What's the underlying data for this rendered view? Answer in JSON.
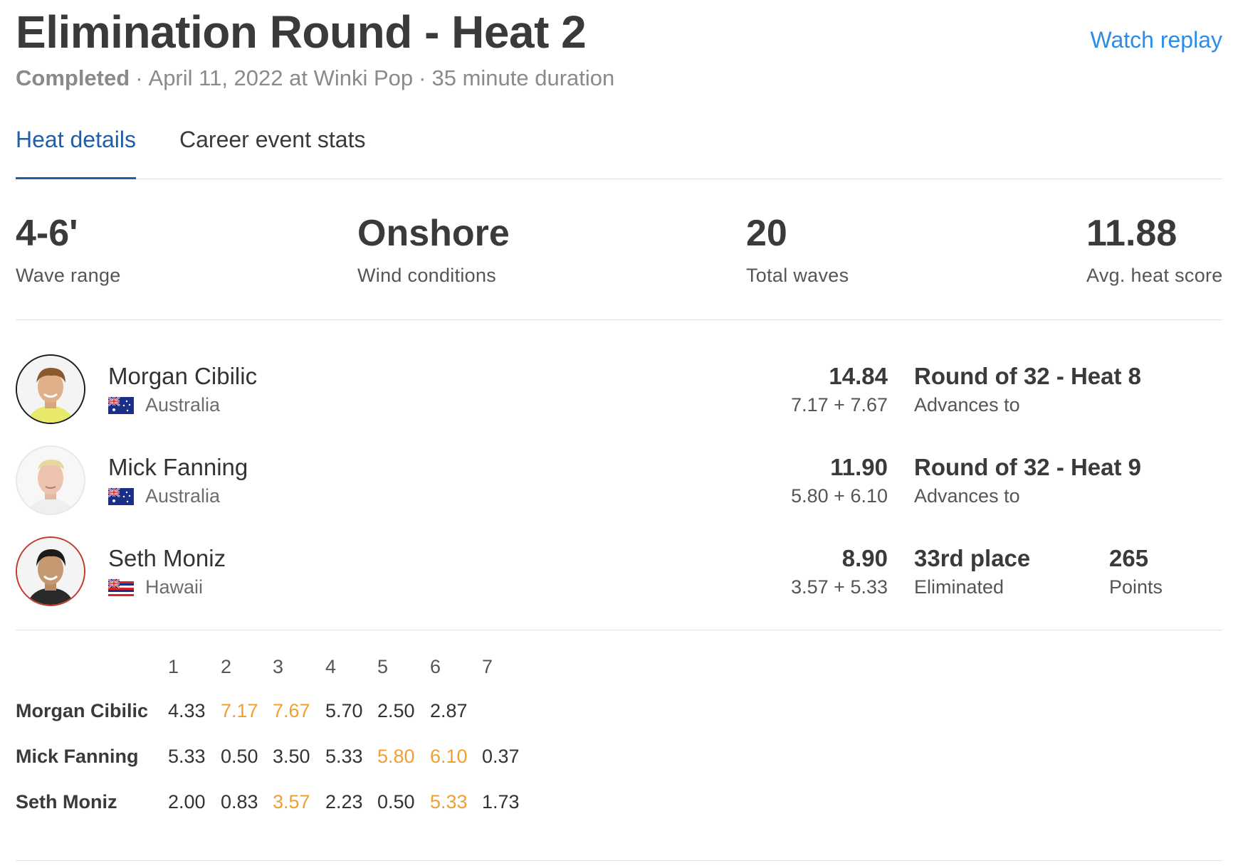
{
  "header": {
    "title": "Elimination Round - Heat 2",
    "watch_replay": "Watch replay",
    "status": "Completed",
    "separator": "·",
    "date_location": "April 11, 2022 at Winki Pop",
    "duration": "35 minute duration"
  },
  "tabs": [
    {
      "label": "Heat details",
      "active": true
    },
    {
      "label": "Career event stats",
      "active": false
    }
  ],
  "stats": [
    {
      "value": "4-6'",
      "label": "Wave range"
    },
    {
      "value": "Onshore",
      "label": "Wind conditions"
    },
    {
      "value": "20",
      "label": "Total waves"
    },
    {
      "value": "11.88",
      "label": "Avg. heat score"
    }
  ],
  "surfers": [
    {
      "name": "Morgan Cibilic",
      "country": "Australia",
      "flag": "australia-flag",
      "total": "14.84",
      "breakdown": "7.17 + 7.67",
      "result": "Round of 32 - Heat 8",
      "result_sub": "Advances to",
      "points": "",
      "points_sub": ""
    },
    {
      "name": "Mick Fanning",
      "country": "Australia",
      "flag": "australia-flag",
      "total": "11.90",
      "breakdown": "5.80 + 6.10",
      "result": "Round of 32 - Heat 9",
      "result_sub": "Advances to",
      "points": "",
      "points_sub": ""
    },
    {
      "name": "Seth Moniz",
      "country": "Hawaii",
      "flag": "hawaii-flag",
      "total": "8.90",
      "breakdown": "3.57 + 5.33",
      "result": "33rd place",
      "result_sub": "Eliminated",
      "points": "265",
      "points_sub": "Points"
    }
  ],
  "wave_grid": {
    "headers": [
      "1",
      "2",
      "3",
      "4",
      "5",
      "6",
      "7"
    ],
    "rows": [
      {
        "name": "Morgan Cibilic",
        "scores": [
          "4.33",
          "7.17",
          "7.67",
          "5.70",
          "2.50",
          "2.87",
          ""
        ],
        "counting": [
          false,
          true,
          true,
          false,
          false,
          false,
          false
        ]
      },
      {
        "name": "Mick Fanning",
        "scores": [
          "5.33",
          "0.50",
          "3.50",
          "5.33",
          "5.80",
          "6.10",
          "0.37"
        ],
        "counting": [
          false,
          false,
          false,
          false,
          true,
          true,
          false
        ]
      },
      {
        "name": "Seth Moniz",
        "scores": [
          "2.00",
          "0.83",
          "3.57",
          "2.23",
          "0.50",
          "5.33",
          "1.73"
        ],
        "counting": [
          false,
          false,
          true,
          false,
          false,
          true,
          false
        ]
      }
    ]
  },
  "colors": {
    "accent_link": "#2b8de8",
    "tab_active": "#1f5fa8",
    "counting_wave": "#f0a030"
  }
}
